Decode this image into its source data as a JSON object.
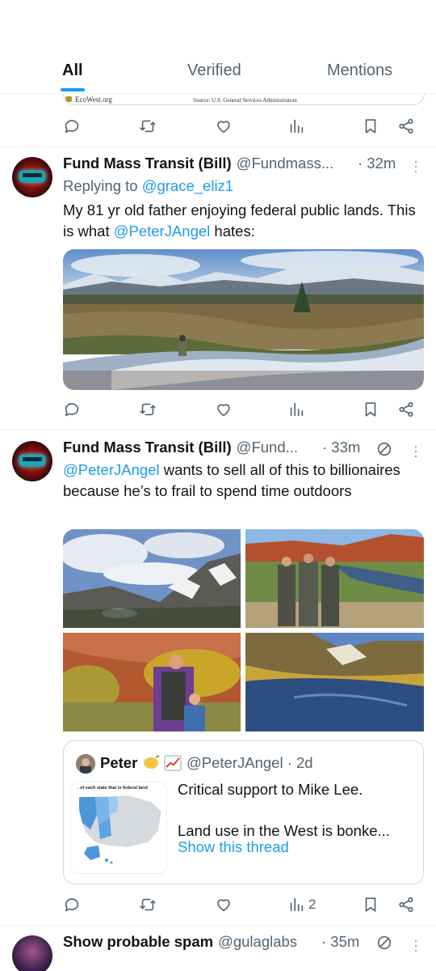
{
  "tabs": [
    {
      "label": "All",
      "active": true
    },
    {
      "label": "Verified",
      "active": false
    },
    {
      "label": "Mentions",
      "active": false
    }
  ],
  "previous_card": {
    "ecowest_label": "EcoWest.org",
    "source_label": "Source: U.S. General Services Administration"
  },
  "icons": [
    "reply-icon",
    "retweet-icon",
    "like-icon",
    "views-icon",
    "bookmark-icon",
    "share-icon",
    "more-icon",
    "muted-icon"
  ],
  "tweets": [
    {
      "name": "Fund Mass Transit (Bill)",
      "handle": "@Fundmass...",
      "time": "· 32m",
      "replying_prefix": "Replying to ",
      "replying_to": "@grace_eliz1",
      "text_part1": "My 81 yr old father enjoying federal public lands. This is what ",
      "mention": "@PeterJAngel",
      "text_part2": " hates:"
    },
    {
      "name": "Fund Mass Transit (Bill)",
      "handle": "@Fund...",
      "time": "· 33m",
      "mention": "@PeterJAngel",
      "text": " wants to sell all of this to billionaires because he’s to frail to spend time outdoors",
      "quote": {
        "name": "Peter",
        "handle": "@PeterJAngel · 2d",
        "thumb_caption": ". of each state that is federal land",
        "line1": "Critical support to Mike Lee.",
        "line2": "Land use in the West is bonke...",
        "show_thread": "Show this thread"
      },
      "views": "2"
    },
    {
      "name": "Show probable spam",
      "handle": "@gulaglabs",
      "time": "· 35m"
    }
  ],
  "colors": {
    "accent": "#1d9bf0",
    "secondary_text": "#536471",
    "primary_text": "#0f1419",
    "border": "#cfd9de"
  }
}
